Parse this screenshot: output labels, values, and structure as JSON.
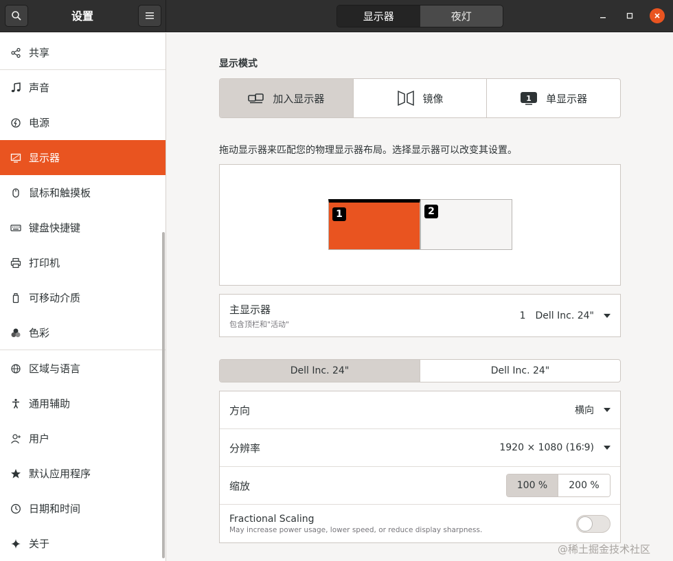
{
  "header": {
    "title": "设置",
    "tabs": [
      {
        "label": "显示器",
        "active": true
      },
      {
        "label": "夜灯",
        "active": false
      }
    ],
    "window_controls": {
      "minimize": "−",
      "maximize": "□",
      "close": "✕"
    }
  },
  "sidebar": {
    "items": [
      {
        "label": "共享",
        "icon": "share-icon"
      },
      {
        "label": "声音",
        "icon": "music-note-icon"
      },
      {
        "label": "电源",
        "icon": "power-icon"
      },
      {
        "label": "显示器",
        "icon": "display-icon",
        "active": true
      },
      {
        "label": "鼠标和触摸板",
        "icon": "mouse-icon"
      },
      {
        "label": "键盘快捷键",
        "icon": "keyboard-icon"
      },
      {
        "label": "打印机",
        "icon": "printer-icon"
      },
      {
        "label": "可移动介质",
        "icon": "removable-media-icon"
      },
      {
        "label": "色彩",
        "icon": "color-icon"
      },
      {
        "label": "区域与语言",
        "icon": "globe-icon"
      },
      {
        "label": "通用辅助",
        "icon": "accessibility-icon"
      },
      {
        "label": "用户",
        "icon": "user-icon"
      },
      {
        "label": "默认应用程序",
        "icon": "star-icon"
      },
      {
        "label": "日期和时间",
        "icon": "clock-icon"
      },
      {
        "label": "关于",
        "icon": "sparkle-icon"
      }
    ]
  },
  "main": {
    "display_mode_label": "显示模式",
    "modes": [
      {
        "label": "加入显示器",
        "icon": "join-displays-icon",
        "active": true
      },
      {
        "label": "镜像",
        "icon": "mirror-icon",
        "active": false
      },
      {
        "label": "单显示器",
        "icon": "single-display-icon",
        "active": false
      }
    ],
    "arrange_desc": "拖动显示器来匹配您的物理显示器布局。选择显示器可以改变其设置。",
    "monitors": [
      {
        "number": "1",
        "color": "#e95420",
        "primary": true
      },
      {
        "number": "2",
        "color": "#f6f5f4",
        "primary": false
      }
    ],
    "primary_display": {
      "label": "主显示器",
      "sublabel": "包含顶栏和\"活动\"",
      "number": "1",
      "value": "Dell Inc. 24\""
    },
    "monitor_tabs": [
      {
        "label": "Dell Inc. 24\"",
        "active": true
      },
      {
        "label": "Dell Inc. 24\"",
        "active": false
      }
    ],
    "settings": {
      "orientation": {
        "label": "方向",
        "value": "横向"
      },
      "resolution": {
        "label": "分辨率",
        "value": "1920 × 1080 (16∶9)"
      },
      "scale": {
        "label": "缩放",
        "options": [
          "100 %",
          "200 %"
        ],
        "selected": "100 %"
      },
      "fractional": {
        "label": "Fractional Scaling",
        "sublabel": "May increase power usage, lower speed, or reduce display sharpness.",
        "enabled": false
      }
    }
  },
  "colors": {
    "accent": "#e95420",
    "headerbar": "#2f2f2f"
  },
  "watermark": "@稀土掘金技术社区"
}
